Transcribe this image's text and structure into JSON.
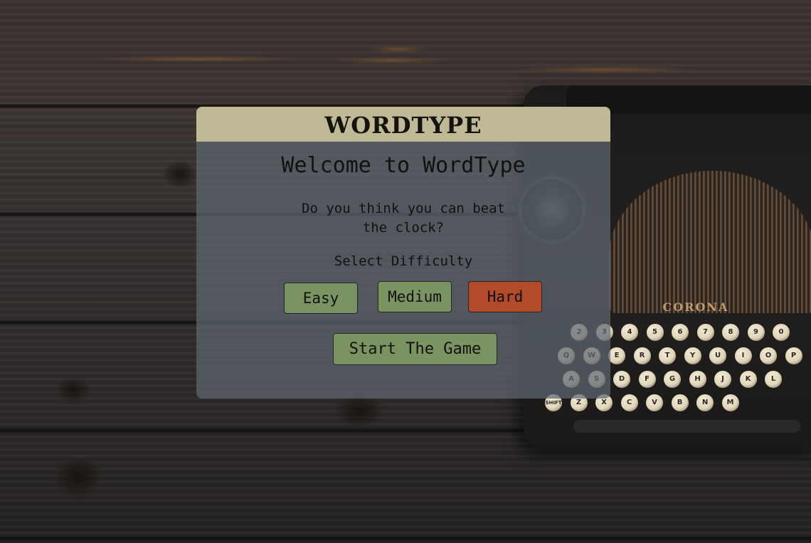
{
  "app": {
    "logo_text": "WORDTYPE",
    "welcome_heading": "Welcome to WordType",
    "subtitle": "Do you think you can beat the clock?",
    "difficulty_label": "Select Difficulty"
  },
  "difficulty_buttons": {
    "easy": "Easy",
    "medium": "Medium",
    "hard": "Hard",
    "selected": "Hard"
  },
  "start_button": "Start The Game",
  "background": {
    "typewriter_brand": "CORONA",
    "keys": [
      "2",
      "3",
      "4",
      "5",
      "6",
      "7",
      "8",
      "9",
      "0",
      "Q",
      "W",
      "E",
      "R",
      "T",
      "Y",
      "U",
      "I",
      "O",
      "P",
      "A",
      "S",
      "D",
      "F",
      "G",
      "H",
      "J",
      "K",
      "L",
      "SHIFT",
      "Z",
      "X",
      "C",
      "V",
      "B",
      "N",
      "M"
    ]
  },
  "colors": {
    "header_bg": "#bfba95",
    "panel_bg": "rgba(96,104,114,0.72)",
    "button_green": "#7a9360",
    "button_selected_red": "#b34a2b"
  }
}
